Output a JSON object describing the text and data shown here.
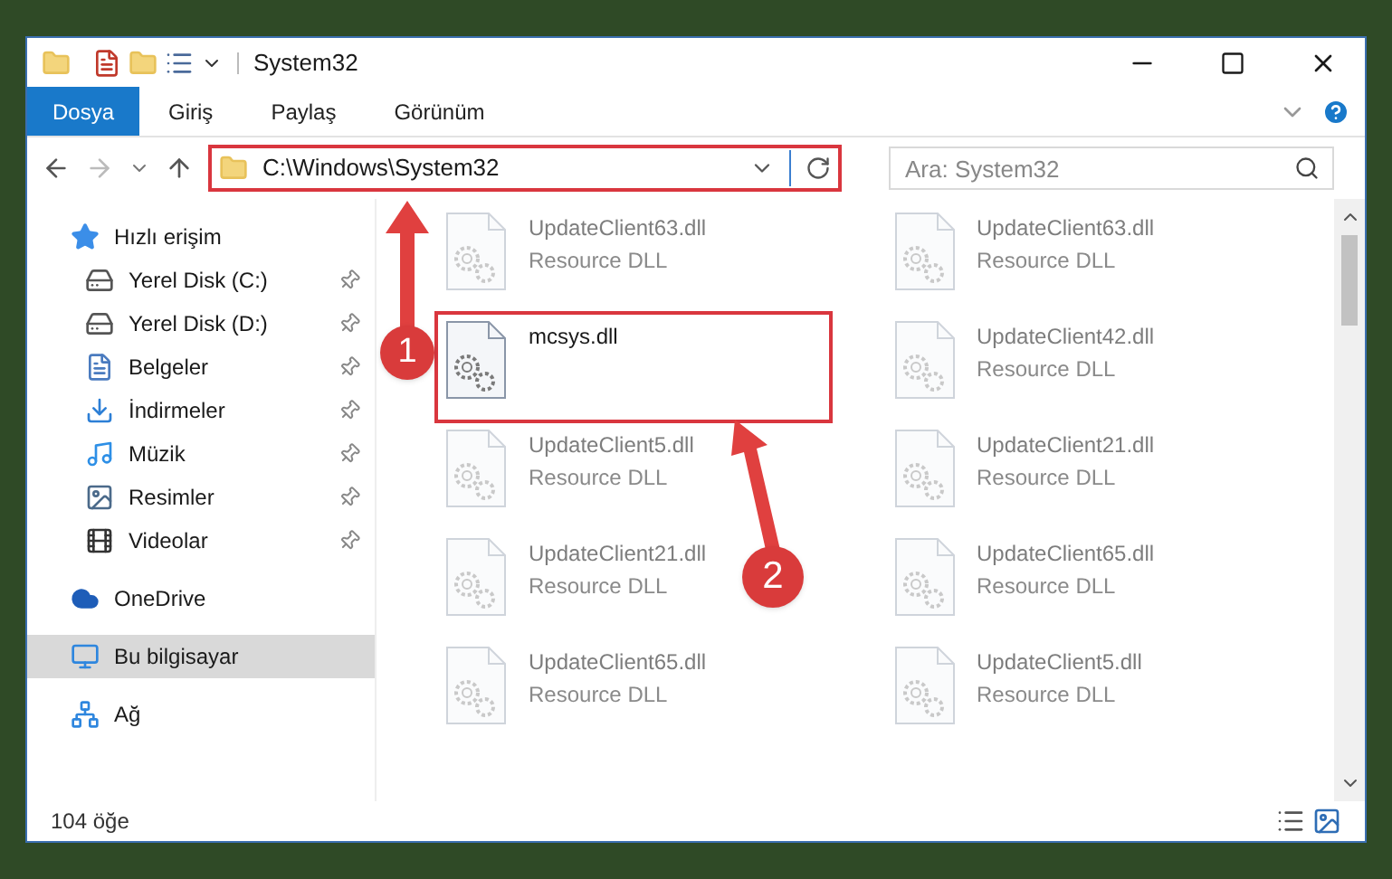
{
  "window": {
    "title": "System32"
  },
  "ribbon_tabs": [
    {
      "label": "Dosya",
      "selected": true
    },
    {
      "label": "Giriş",
      "selected": false
    },
    {
      "label": "Paylaş",
      "selected": false
    },
    {
      "label": "Görünüm",
      "selected": false
    }
  ],
  "address_bar": {
    "path": "C:\\Windows\\System32"
  },
  "search": {
    "placeholder": "Ara: System32"
  },
  "sidebar": {
    "items": [
      {
        "label": "Hızlı erişim",
        "kind": "star",
        "pinned": false,
        "selected": false,
        "group": true
      },
      {
        "label": "Yerel Disk (C:)",
        "kind": "disk",
        "pinned": true,
        "selected": false,
        "group": false
      },
      {
        "label": "Yerel Disk (D:)",
        "kind": "disk",
        "pinned": true,
        "selected": false,
        "group": false
      },
      {
        "label": "Belgeler",
        "kind": "document",
        "pinned": true,
        "selected": false,
        "group": false
      },
      {
        "label": "İndirmeler",
        "kind": "download",
        "pinned": true,
        "selected": false,
        "group": false
      },
      {
        "label": "Müzik",
        "kind": "music",
        "pinned": true,
        "selected": false,
        "group": false
      },
      {
        "label": "Resimler",
        "kind": "image",
        "pinned": true,
        "selected": false,
        "group": false
      },
      {
        "label": "Videolar",
        "kind": "video",
        "pinned": true,
        "selected": false,
        "group": false
      },
      {
        "label": "OneDrive",
        "kind": "cloud",
        "pinned": false,
        "selected": false,
        "group": true
      },
      {
        "label": "Bu bilgisayar",
        "kind": "computer",
        "pinned": false,
        "selected": true,
        "group": true
      },
      {
        "label": "Ağ",
        "kind": "network",
        "pinned": false,
        "selected": false,
        "group": true
      }
    ]
  },
  "files": [
    {
      "name": "UpdateClient63.dll",
      "type": "Resource DLL",
      "blurred": true,
      "highlighted": false
    },
    {
      "name": "UpdateClient63.dll",
      "type": "Resource DLL",
      "blurred": true,
      "highlighted": false
    },
    {
      "name": "mcsys.dll",
      "blurred": false,
      "highlighted": true
    },
    {
      "name": "UpdateClient42.dll",
      "type": "Resource DLL",
      "blurred": true,
      "highlighted": false
    },
    {
      "name": "UpdateClient5.dll",
      "type": "Resource DLL",
      "blurred": true,
      "highlighted": false
    },
    {
      "name": "UpdateClient21.dll",
      "type": "Resource DLL",
      "blurred": true,
      "highlighted": false
    },
    {
      "name": "UpdateClient21.dll",
      "type": "Resource DLL",
      "blurred": true,
      "highlighted": false
    },
    {
      "name": "UpdateClient65.dll",
      "type": "Resource DLL",
      "blurred": true,
      "highlighted": false
    },
    {
      "name": "UpdateClient65.dll",
      "type": "Resource DLL",
      "blurred": true,
      "highlighted": false
    },
    {
      "name": "UpdateClient5.dll",
      "type": "Resource DLL",
      "blurred": true,
      "highlighted": false
    }
  ],
  "status_bar": {
    "item_count": "104 öğe"
  },
  "annotations": {
    "address_highlighted": true,
    "markers": [
      "1",
      "2"
    ]
  }
}
